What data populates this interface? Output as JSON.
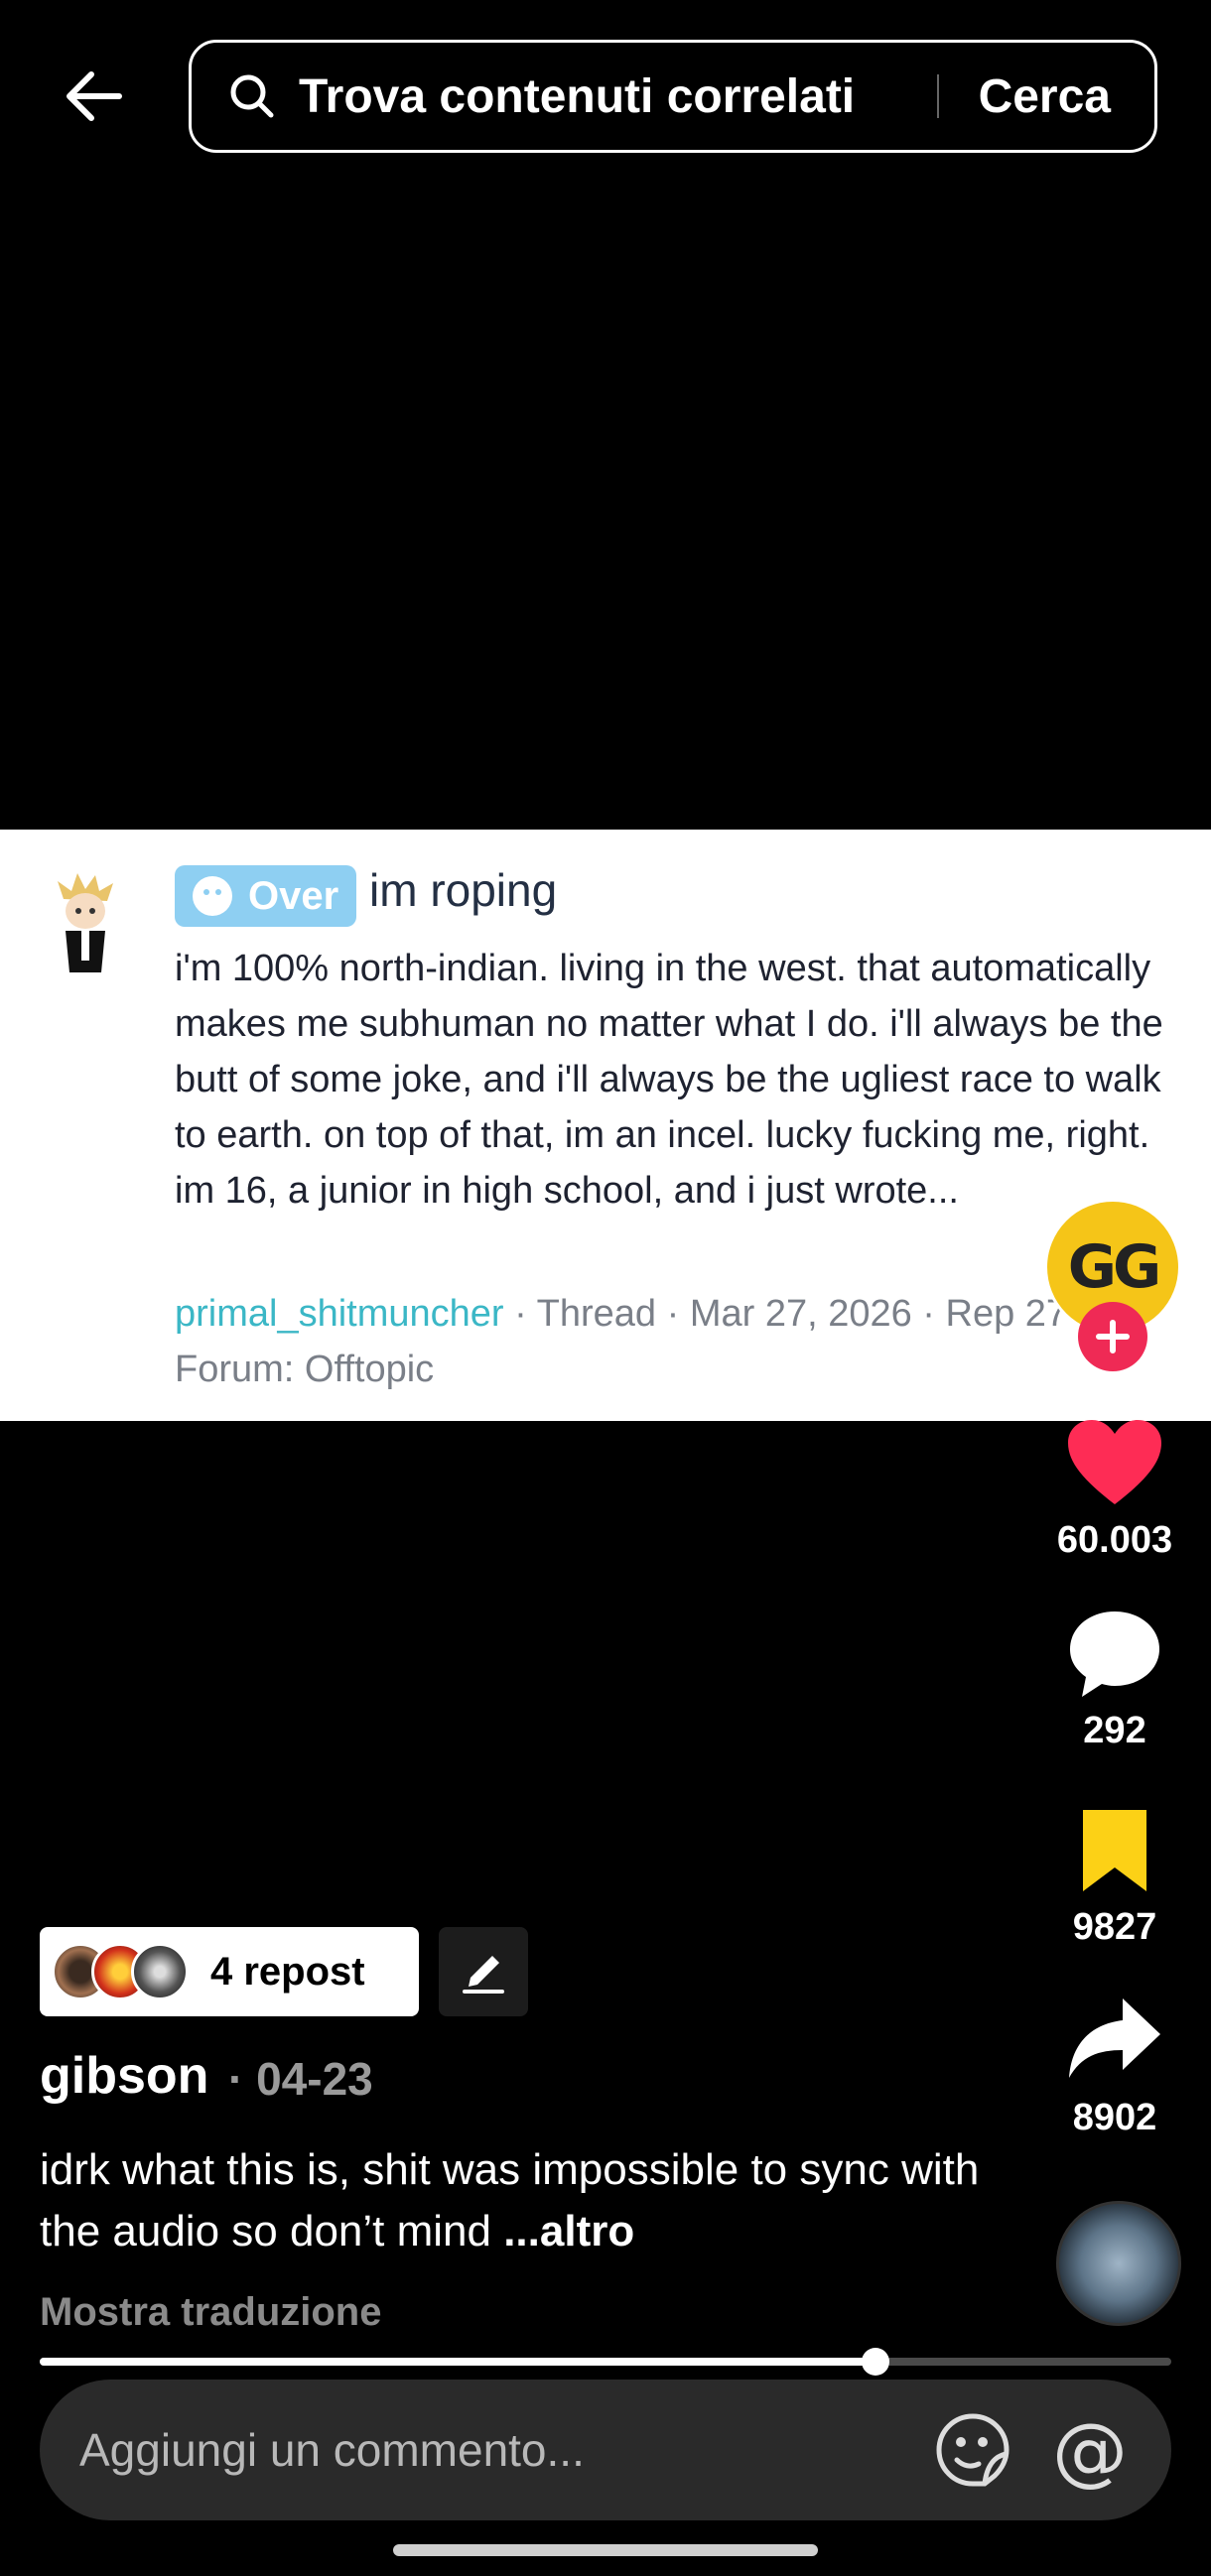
{
  "topbar": {
    "search_text": "Trova contenuti correlati",
    "search_button": "Cerca"
  },
  "post_image": {
    "tag": "Over",
    "title": "im roping",
    "body": "i'm 100% north-indian. living in the west. that automatically makes me subhuman no matter what I do. i'll always be the butt of some joke, and i'll always be the ugliest race to walk to earth. on top of that, im an incel. lucky fucking me, right. im 16, a junior in high school, and i just wrote...",
    "author": "primal_shitmuncher",
    "meta_rest": " · Thread · Mar 27, 2026 · Rep 27 · Forum: Offtopic"
  },
  "actions": {
    "likes": "60.003",
    "comments": "292",
    "saves": "9827",
    "shares": "8902"
  },
  "repost": {
    "label": "4 repost"
  },
  "caption": {
    "username": "gibson",
    "date": "· 04-23",
    "text": "idrk what this is, shit was impossible to sync with the audio so don’t mind ",
    "more": "...altro",
    "translate": "Mostra traduzione"
  },
  "progress": {
    "fraction": 0.74
  },
  "comment_bar": {
    "placeholder": "Aggiungi un commento..."
  },
  "colors": {
    "like": "#fe2c55",
    "save": "#fcd116",
    "follow": "#ef2a55",
    "tag": "#8ecff2",
    "author_link": "#3bb7c6"
  },
  "icons": [
    "back-arrow-icon",
    "search-icon",
    "heart-icon",
    "comment-bubble-icon",
    "bookmark-icon",
    "share-arrow-icon",
    "plus-icon",
    "pencil-icon",
    "emoji-sticker-icon",
    "at-mention-icon"
  ]
}
